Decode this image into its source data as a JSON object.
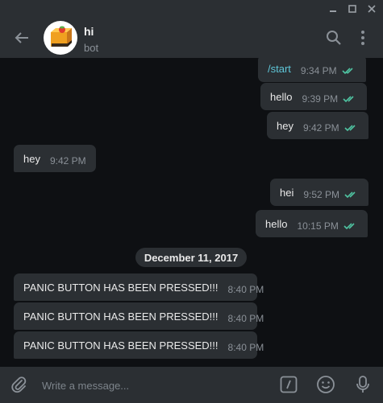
{
  "header": {
    "title": "hi",
    "subtitle": "bot"
  },
  "messages": [
    {
      "text": "/start",
      "time": "9:34 PM",
      "dir": "out",
      "cmd": true
    },
    {
      "text": "hello",
      "time": "9:39 PM",
      "dir": "out"
    },
    {
      "text": "hey",
      "time": "9:42 PM",
      "dir": "out"
    },
    {
      "text": "hey",
      "time": "9:42 PM",
      "dir": "in"
    },
    {
      "text": "hei",
      "time": "9:52 PM",
      "dir": "out"
    },
    {
      "text": "hello",
      "time": "10:15 PM",
      "dir": "out"
    },
    {
      "text": "PANIC BUTTON HAS BEEN PRESSED!!!",
      "time": "8:40 PM",
      "dir": "in"
    },
    {
      "text": "PANIC BUTTON HAS BEEN PRESSED!!!",
      "time": "8:40 PM",
      "dir": "in"
    },
    {
      "text": "PANIC BUTTON HAS BEEN PRESSED!!!",
      "time": "8:40 PM",
      "dir": "in"
    }
  ],
  "date_separator": "December 11, 2017",
  "composer": {
    "placeholder": "Write a message..."
  },
  "colors": {
    "read_check": "#4fc3a1",
    "bubble": "#2b2f33",
    "background": "#0e1013"
  }
}
